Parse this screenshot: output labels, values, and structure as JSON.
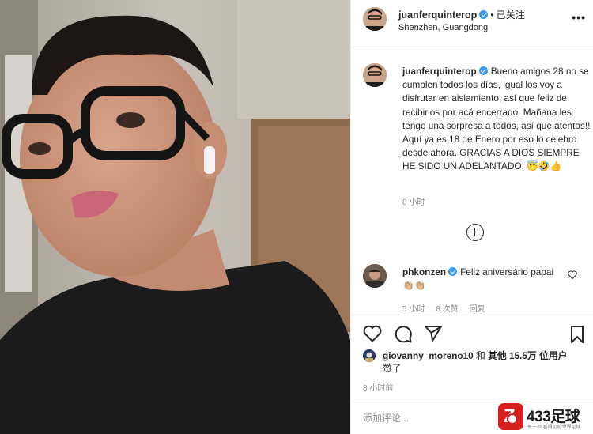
{
  "header": {
    "username": "juanferquinterop",
    "separator": "•",
    "follow_status": "已关注",
    "location": "Shenzhen, Guangdong",
    "more_icon": "more-horizontal-icon"
  },
  "caption": {
    "username": "juanferquinterop",
    "text": "Bueno amigos 28 no se cumplen todos los días, igual los voy a disfrutar en aislamiento, así que feliz de recibirlos por acá encerrado. Mañana les tengo una sorpresa a todos, así que atentos!! Aquí ya es 18 de Enero por eso lo celebro desde ahora. GRACIAS A DIOS SIEMPRE HE SIDO UN ADELANTADO. 😇🤣👍",
    "time": "8 小时"
  },
  "load_more_icon": "plus-circle-icon",
  "comment": {
    "username": "phkonzen",
    "text": "Feliz aniversário papai 👏🏼👏🏼",
    "time": "5 小时",
    "likes": "8 次赞",
    "reply": "回复"
  },
  "actions": {
    "like_icon": "heart-icon",
    "comment_icon": "comment-icon",
    "share_icon": "paper-plane-icon",
    "save_icon": "bookmark-icon"
  },
  "likes": {
    "user": "giovanny_moreno10",
    "and": "和",
    "others_prefix": "其他",
    "others_count": "15.5万",
    "others_suffix": "位用户",
    "liked": "赞了"
  },
  "post_time": "8 小时前",
  "add_comment": {
    "placeholder": "添加评论..."
  },
  "watermark": {
    "brand": "433足球",
    "sub": "每一秒 看得见的世界足球"
  },
  "colors": {
    "verified": "#3897f0",
    "muted": "#8e8e8e",
    "text": "#262626",
    "watermark_red": "#d62020"
  }
}
